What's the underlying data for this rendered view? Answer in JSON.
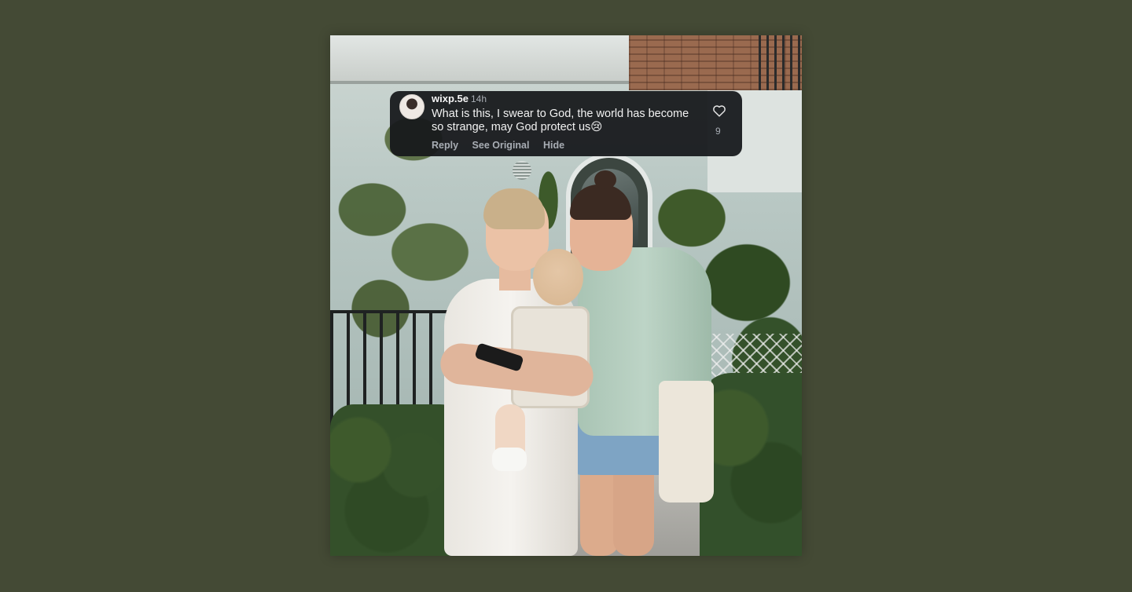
{
  "comment": {
    "username": "wixp.5e",
    "time": "14h",
    "text": "What is this, I swear to God, the world has become so strange, may God protect us😢",
    "actions": {
      "reply": "Reply",
      "see_original": "See Original",
      "hide": "Hide"
    },
    "likes": "9",
    "like_icon": "heart-outline-icon"
  },
  "colors": {
    "background": "#444a35",
    "comment_bg": "#16181c",
    "muted_text": "#a8adb4"
  }
}
